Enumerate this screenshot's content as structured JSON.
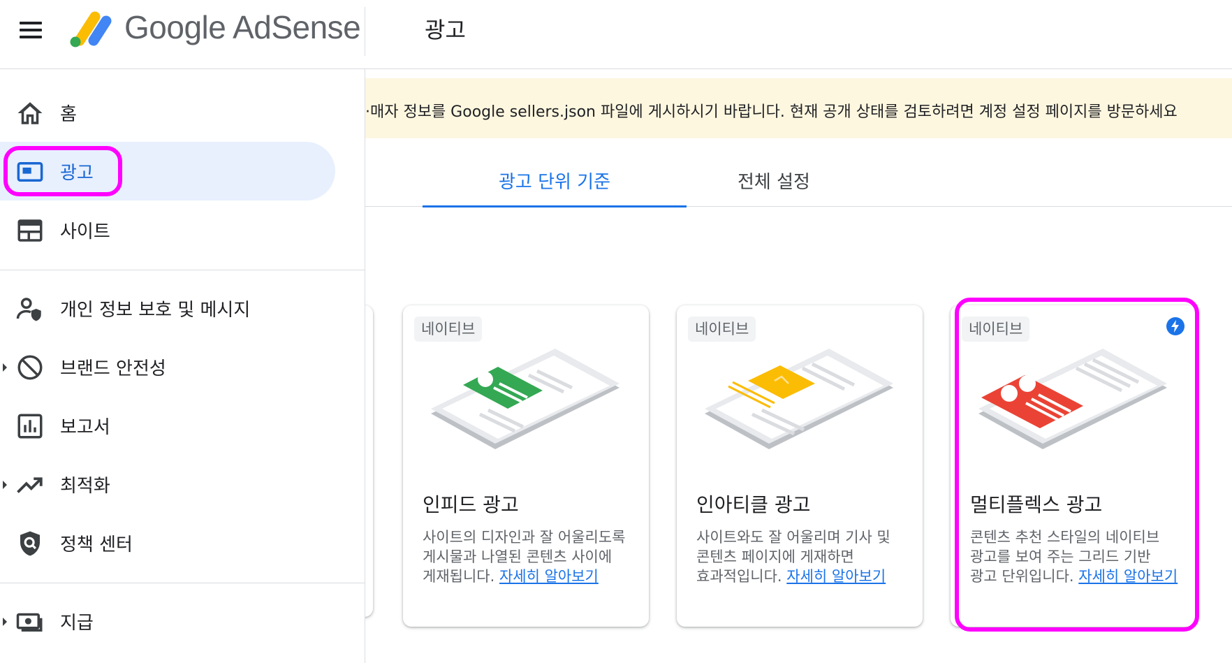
{
  "header": {
    "brand": "Google AdSense",
    "page_title": "광고"
  },
  "sidebar": {
    "items": [
      {
        "label": "홈",
        "icon": "home-icon"
      },
      {
        "label": "광고",
        "icon": "ads-icon"
      },
      {
        "label": "사이트",
        "icon": "sites-icon"
      },
      {
        "label": "개인 정보 보호 및 메시지",
        "icon": "privacy-messaging-icon"
      },
      {
        "label": "브랜드 안전성",
        "icon": "block-icon"
      },
      {
        "label": "보고서",
        "icon": "reports-icon"
      },
      {
        "label": "최적화",
        "icon": "trending-up-icon"
      },
      {
        "label": "정책 센터",
        "icon": "policy-shield-icon"
      },
      {
        "label": "지급",
        "icon": "payments-icon"
      }
    ]
  },
  "banner": {
    "text": "·매자 정보를 Google sellers.json 파일에 게시하시기 바랍니다. 현재 공개 상태를 검토하려면 계정 설정 페이지를 방문하세요"
  },
  "tabs": [
    {
      "label": "광고 단위 기준",
      "active": true
    },
    {
      "label": "전체 설정",
      "active": false
    }
  ],
  "cards": [
    {
      "chip": "네이티브",
      "title": "인피드 광고",
      "desc": "사이트의 디자인과 잘 어울리도록 게시물과 나열된 콘텐츠 사이에 게재됩니다. ",
      "link": "자세히 알아보기",
      "accent": "#34a853"
    },
    {
      "chip": "네이티브",
      "title": "인아티클 광고",
      "desc": "사이트와도 잘 어울리며 기사 및 콘텐츠 페이지에 게재하면 효과적입니다. ",
      "link": "자세히 알아보기",
      "accent": "#fbbc04"
    },
    {
      "chip": "네이티브",
      "title": "멀티플렉스 광고",
      "desc": "콘텐츠 추천 스타일의 네이티브 광고를 보여 주는 그리드 기반 광고 단위입니다. ",
      "link": "자세히 알아보기",
      "accent": "#ea4335",
      "badge_icon": "bolt-icon"
    }
  ],
  "colors": {
    "active_blue": "#1a73e8",
    "highlight": "#ff00ff",
    "banner_bg": "#fef7e0"
  }
}
